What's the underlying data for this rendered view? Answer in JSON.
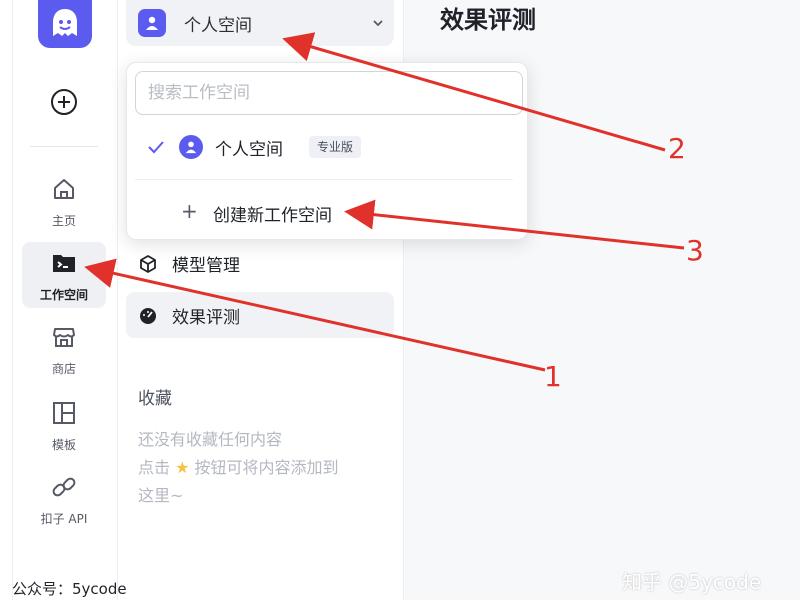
{
  "rail": {
    "items": [
      {
        "label": "主页",
        "icon": "home-icon"
      },
      {
        "label": "工作空间",
        "icon": "terminal-folder-icon"
      },
      {
        "label": "商店",
        "icon": "store-icon"
      },
      {
        "label": "模板",
        "icon": "layout-grid-icon"
      },
      {
        "label": "扣子 API",
        "icon": "link-icon"
      }
    ],
    "active": "工作空间"
  },
  "workspace": {
    "current": "个人空间"
  },
  "menu": {
    "items": [
      {
        "label": "模型管理",
        "icon": "cube-icon"
      },
      {
        "label": "效果评测",
        "icon": "gauge-icon"
      }
    ],
    "active": "效果评测"
  },
  "favorites": {
    "title": "收藏",
    "empty_line1": "还没有收藏任何内容",
    "empty_line2_pre": "点击",
    "empty_line2_post": "按钮可将内容添加到",
    "empty_line3": "这里~"
  },
  "main": {
    "title": "效果评测"
  },
  "dropdown": {
    "search_placeholder": "搜索工作空间",
    "option_name": "个人空间",
    "option_badge": "专业版",
    "create_label": "创建新工作空间"
  },
  "annotations": [
    "1",
    "2",
    "3"
  ],
  "watermarks": {
    "left": "公众号：5ycode",
    "right": "知乎 @5ycode"
  },
  "colors": {
    "accent": "#5b5bf0",
    "annotation": "#e0322a"
  }
}
